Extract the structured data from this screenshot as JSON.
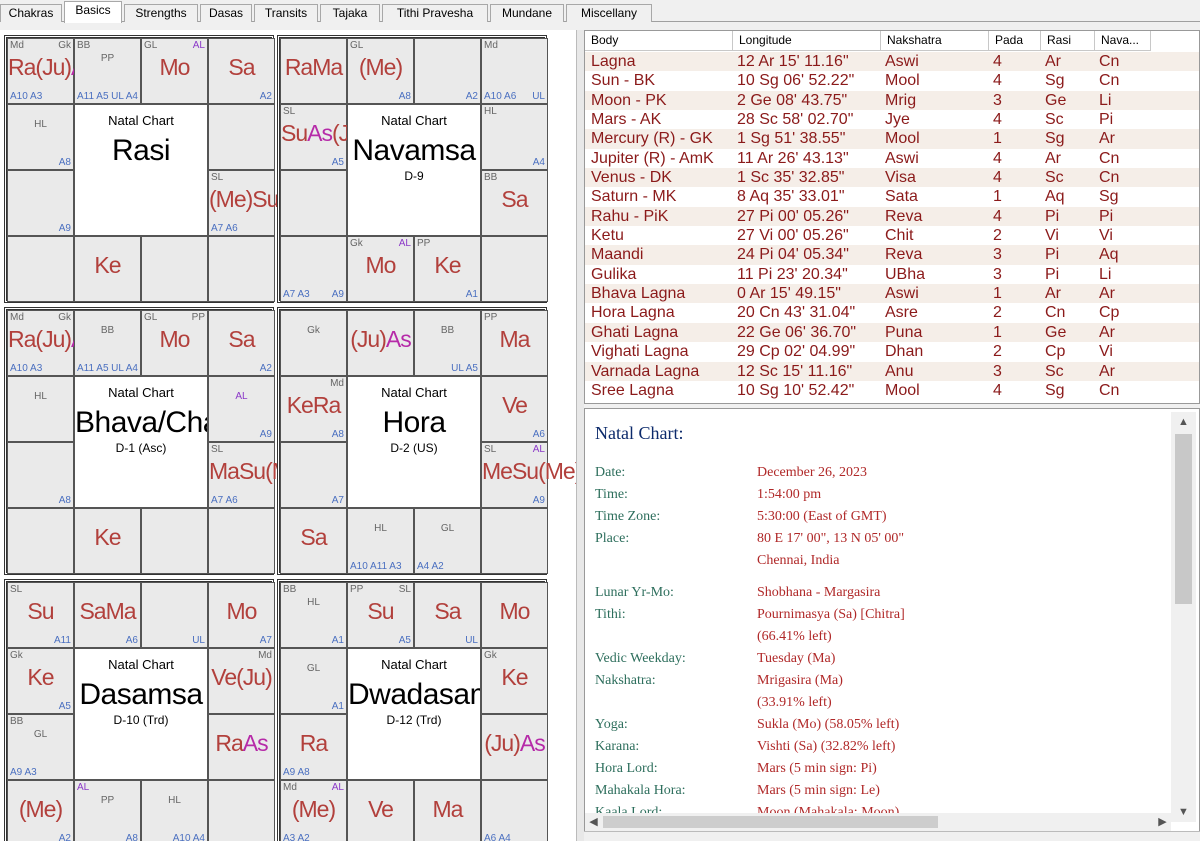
{
  "tabs": [
    "Chakras",
    "Basics",
    "Strengths",
    "Dasas",
    "Transits",
    "Tajaka",
    "Tithi Pravesha",
    "Mundane",
    "Miscellany"
  ],
  "active_tab": "Basics",
  "charts": [
    {
      "title": "Natal Chart",
      "name": "Rasi",
      "sub": "",
      "cells": [
        {
          "p": [
            "Ra",
            "(Ju)",
            "As"
          ],
          "tl": "Md",
          "tr": "Gk",
          "bl": "A10  A3",
          "br": ""
        },
        {
          "p": [],
          "tl": "BB",
          "tr": "",
          "tm": "PP",
          "bl": "A11  A5",
          "br": "UL   A4"
        },
        {
          "p": [
            "Mo"
          ],
          "tl": "GL",
          "tr": "AL",
          "bl": "",
          "br": ""
        },
        {
          "p": [
            "Sa"
          ],
          "tl": "",
          "tr": "",
          "bl": "",
          "br": "A2"
        },
        {
          "p": [],
          "tl": "",
          "tr": "",
          "tm": "HL",
          "bl": "",
          "br": "A8"
        },
        {
          "p": [],
          "tl": "",
          "tr": "",
          "bl": "",
          "br": ""
        },
        {
          "p": [],
          "tl": "",
          "tr": "",
          "bl": "",
          "br": "A9"
        },
        {
          "p": [
            "(Me)",
            "Su",
            "Ve",
            "Ma"
          ],
          "tl": "SL",
          "tr": "",
          "bl": "A7  A6",
          "br": ""
        },
        {
          "p": [],
          "tl": "",
          "tr": "",
          "bl": "",
          "br": ""
        },
        {
          "p": [
            "Ke"
          ],
          "tl": "",
          "tr": "",
          "bl": "",
          "br": ""
        },
        {
          "p": [],
          "tl": "",
          "tr": "",
          "bl": "",
          "br": ""
        },
        {
          "p": [],
          "tl": "",
          "tr": "",
          "bl": "",
          "br": ""
        }
      ]
    },
    {
      "title": "Natal Chart",
      "name": "Navamsa",
      "sub": "D-9",
      "cells": [
        {
          "p": [
            "Ra",
            "Ma"
          ],
          "tl": "",
          "tr": "",
          "bl": "",
          "br": ""
        },
        {
          "p": [
            "(Me)"
          ],
          "tl": "GL",
          "tr": "",
          "bl": "",
          "br": "A8"
        },
        {
          "p": [],
          "tl": "",
          "tr": "",
          "bl": "",
          "br": "A2"
        },
        {
          "p": [],
          "tl": "Md",
          "tr": "",
          "bl": "A10  A6",
          "br": "UL"
        },
        {
          "p": [
            "Su",
            "As",
            "(Ju)",
            "Ve"
          ],
          "tl": "SL",
          "tr": "",
          "bl": "",
          "br": "A5"
        },
        {
          "p": [],
          "tl": "HL",
          "tr": "",
          "bl": "",
          "br": "A4"
        },
        {
          "p": [],
          "tl": "",
          "tr": "",
          "bl": "",
          "br": ""
        },
        {
          "p": [
            "Sa"
          ],
          "tl": "BB",
          "tr": "",
          "bl": "",
          "br": ""
        },
        {
          "p": [],
          "tl": "",
          "tr": "",
          "bl": "A7  A3",
          "br": "A9"
        },
        {
          "p": [
            "Mo"
          ],
          "tl": "Gk",
          "tr": "AL",
          "bl": "",
          "br": ""
        },
        {
          "p": [
            "Ke"
          ],
          "tl": "PP",
          "tr": "",
          "bl": "",
          "br": "A1"
        },
        {
          "p": [],
          "tl": "",
          "tr": "",
          "bl": "",
          "br": ""
        }
      ]
    },
    {
      "title": "Natal Chart",
      "name": "Bhava/Chalit",
      "sub": "D-1 (Asc)",
      "cells": [
        {
          "p": [
            "Ra",
            "(Ju)",
            "As"
          ],
          "tl": "Md",
          "tr": "Gk",
          "bl": "A10  A3",
          "br": ""
        },
        {
          "p": [],
          "tl": "",
          "tr": "",
          "tm": "BB",
          "bl": "A11  A5",
          "br": "UL   A4"
        },
        {
          "p": [
            "Mo"
          ],
          "tl": "GL",
          "tr": "PP",
          "bl": "",
          "br": ""
        },
        {
          "p": [
            "Sa"
          ],
          "tl": "",
          "tr": "",
          "bl": "",
          "br": "A2"
        },
        {
          "p": [],
          "tl": "",
          "tr": "",
          "tm": "HL",
          "bl": "",
          "br": ""
        },
        {
          "p": [],
          "tl": "",
          "tr": "",
          "tm": "AL",
          "bl": "",
          "br": "A9"
        },
        {
          "p": [],
          "tl": "",
          "tr": "",
          "bl": "",
          "br": "A8"
        },
        {
          "p": [
            "Ma",
            "Su",
            "(Me)",
            "Ve"
          ],
          "tl": "SL",
          "tr": "",
          "bl": "A7  A6",
          "br": ""
        },
        {
          "p": [],
          "tl": "",
          "tr": "",
          "bl": "",
          "br": ""
        },
        {
          "p": [
            "Ke"
          ],
          "tl": "",
          "tr": "",
          "bl": "",
          "br": ""
        },
        {
          "p": [],
          "tl": "",
          "tr": "",
          "bl": "",
          "br": ""
        },
        {
          "p": [],
          "tl": "",
          "tr": "",
          "bl": "",
          "br": ""
        }
      ]
    },
    {
      "title": "Natal Chart",
      "name": "Hora",
      "sub": "D-2 (US)",
      "cells": [
        {
          "p": [],
          "tl": "",
          "tr": "",
          "tm": "Gk",
          "bl": "",
          "br": ""
        },
        {
          "p": [
            "(Ju)",
            "As"
          ],
          "tl": "",
          "tr": "",
          "bl": "",
          "br": ""
        },
        {
          "p": [],
          "tl": "",
          "tr": "",
          "tm": "BB",
          "bl": "",
          "br": "UL  A5"
        },
        {
          "p": [
            "Ma"
          ],
          "tl": "PP",
          "tr": "",
          "bl": "",
          "br": ""
        },
        {
          "p": [
            "Ke",
            "Ra"
          ],
          "tl": "",
          "tr": "Md",
          "bl": "",
          "br": "A8"
        },
        {
          "p": [
            "Ve"
          ],
          "tl": "",
          "tr": "",
          "bl": "",
          "br": "A6"
        },
        {
          "p": [],
          "tl": "",
          "tr": "",
          "bl": "",
          "br": "A7"
        },
        {
          "p": [
            "Me",
            "Su",
            "(Me)"
          ],
          "tl": "SL",
          "tr": "AL",
          "bl": "",
          "br": "A9"
        },
        {
          "p": [
            "Sa"
          ],
          "tl": "",
          "tr": "",
          "bl": "",
          "br": ""
        },
        {
          "p": [],
          "tl": "",
          "tr": "",
          "tm": "HL",
          "bl": "A10  A11  A3",
          "br": ""
        },
        {
          "p": [],
          "tl": "",
          "tr": "",
          "tm": "GL",
          "bl": "A4  A2",
          "br": ""
        },
        {
          "p": [],
          "tl": "",
          "tr": "",
          "bl": "",
          "br": ""
        }
      ]
    },
    {
      "title": "Natal Chart",
      "name": "Dasamsa",
      "sub": "D-10 (Trd)",
      "cells": [
        {
          "p": [
            "Su"
          ],
          "tl": "SL",
          "tr": "",
          "bl": "",
          "br": "A11"
        },
        {
          "p": [
            "Sa",
            "Ma"
          ],
          "tl": "",
          "tr": "",
          "bl": "",
          "br": "A6"
        },
        {
          "p": [],
          "tl": "",
          "tr": "",
          "bl": "",
          "br": "UL"
        },
        {
          "p": [
            "Mo"
          ],
          "tl": "",
          "tr": "",
          "bl": "",
          "br": "A7"
        },
        {
          "p": [
            "Ke"
          ],
          "tl": "Gk",
          "tr": "",
          "bl": "",
          "br": "A5"
        },
        {
          "p": [
            "Ve",
            "(Ju)"
          ],
          "tl": "",
          "tr": "Md",
          "bl": "",
          "br": ""
        },
        {
          "p": [],
          "tl": "BB",
          "tr": "",
          "tm": "GL",
          "bl": "A9  A3",
          "br": ""
        },
        {
          "p": [
            "Ra",
            "As"
          ],
          "tl": "",
          "tr": "",
          "bl": "",
          "br": ""
        },
        {
          "p": [
            "(Me)"
          ],
          "tl": "",
          "tr": "",
          "bl": "",
          "br": "A2"
        },
        {
          "p": [],
          "tl": "AL",
          "tr": "",
          "tm": "PP",
          "bl": "",
          "br": "A8"
        },
        {
          "p": [],
          "tl": "",
          "tr": "",
          "tm": "HL",
          "bl": "",
          "br": "A10  A4"
        },
        {
          "p": [],
          "tl": "",
          "tr": "",
          "bl": "",
          "br": ""
        }
      ]
    },
    {
      "title": "Natal Chart",
      "name": "Dwadasamsa",
      "sub": "D-12 (Trd)",
      "cells": [
        {
          "p": [],
          "tl": "BB",
          "tr": "",
          "tm": "HL",
          "bl": "",
          "br": "A1"
        },
        {
          "p": [
            "Su"
          ],
          "tl": "PP",
          "tr": "SL",
          "bl": "",
          "br": "A5"
        },
        {
          "p": [
            "Sa"
          ],
          "tl": "",
          "tr": "",
          "bl": "",
          "br": "UL"
        },
        {
          "p": [
            "Mo"
          ],
          "tl": "",
          "tr": "",
          "bl": "",
          "br": ""
        },
        {
          "p": [],
          "tl": "",
          "tr": "",
          "tm": "GL",
          "bl": "",
          "br": "A1"
        },
        {
          "p": [
            "Ke"
          ],
          "tl": "Gk",
          "tr": "",
          "bl": "",
          "br": ""
        },
        {
          "p": [
            "Ra"
          ],
          "tl": "",
          "tr": "",
          "bl": "A9  A8",
          "br": ""
        },
        {
          "p": [
            "(Ju)",
            "As"
          ],
          "tl": "",
          "tr": "",
          "bl": "",
          "br": ""
        },
        {
          "p": [
            "(Me)"
          ],
          "tl": "Md",
          "tr": "AL",
          "bl": "A3  A2",
          "br": ""
        },
        {
          "p": [
            "Ve"
          ],
          "tl": "",
          "tr": "",
          "bl": "",
          "br": ""
        },
        {
          "p": [
            "Ma"
          ],
          "tl": "",
          "tr": "",
          "bl": "",
          "br": ""
        },
        {
          "p": [],
          "tl": "",
          "tr": "",
          "bl": "A6  A4",
          "br": ""
        }
      ]
    }
  ],
  "table": {
    "headers": [
      "Body",
      "Longitude",
      "Nakshatra",
      "Pada",
      "Rasi",
      "Nava..."
    ],
    "rows": [
      [
        "Lagna",
        "12 Ar 15' 11.16\"",
        "Aswi",
        "4",
        "Ar",
        "Cn"
      ],
      [
        "Sun - BK",
        "10 Sg 06' 52.22\"",
        "Mool",
        "4",
        "Sg",
        "Cn"
      ],
      [
        "Moon - PK",
        " 2 Ge 08' 43.75\"",
        "Mrig",
        "3",
        "Ge",
        "Li"
      ],
      [
        "Mars - AK",
        "28 Sc 58' 02.70\"",
        "Jye",
        "4",
        "Sc",
        "Pi"
      ],
      [
        "Mercury (R) - GK",
        " 1 Sg 51' 38.55\"",
        "Mool",
        "1",
        "Sg",
        "Ar"
      ],
      [
        "Jupiter (R) - AmK",
        "11 Ar 26' 43.13\"",
        "Aswi",
        "4",
        "Ar",
        "Cn"
      ],
      [
        "Venus - DK",
        " 1 Sc 35' 32.85\"",
        "Visa",
        "4",
        "Sc",
        "Cn"
      ],
      [
        "Saturn - MK",
        " 8 Aq 35' 33.01\"",
        "Sata",
        "1",
        "Aq",
        "Sg"
      ],
      [
        "Rahu - PiK",
        "27 Pi 00' 05.26\"",
        "Reva",
        "4",
        "Pi",
        "Pi"
      ],
      [
        "Ketu",
        "27 Vi 00' 05.26\"",
        "Chit",
        "2",
        "Vi",
        "Vi"
      ],
      [
        "Maandi",
        "24 Pi 04' 05.34\"",
        "Reva",
        "3",
        "Pi",
        "Aq"
      ],
      [
        "Gulika",
        "11 Pi 23' 20.34\"",
        "UBha",
        "3",
        "Pi",
        "Li"
      ],
      [
        "Bhava Lagna",
        " 0 Ar 15' 49.15\"",
        "Aswi",
        "1",
        "Ar",
        "Ar"
      ],
      [
        "Hora Lagna",
        "20 Cn 43' 31.04\"",
        "Asre",
        "2",
        "Cn",
        "Cp"
      ],
      [
        "Ghati Lagna",
        "22 Ge 06' 36.70\"",
        "Puna",
        "1",
        "Ge",
        "Ar"
      ],
      [
        "Vighati Lagna",
        "29 Cp 02' 04.99\"",
        "Dhan",
        "2",
        "Cp",
        "Vi"
      ],
      [
        "Varnada Lagna",
        "12 Sc 15' 11.16\"",
        "Anu",
        "3",
        "Sc",
        "Ar"
      ],
      [
        "Sree Lagna",
        "10 Sg 10' 52.42\"",
        "Mool",
        "4",
        "Sg",
        "Cn"
      ]
    ]
  },
  "details": {
    "title": "Natal Chart:",
    "rows": [
      {
        "k": "Date:",
        "v": "December 26, 2023"
      },
      {
        "k": "Time:",
        "v": "1:54:00 pm"
      },
      {
        "k": "Time Zone:",
        "v": "5:30:00 (East of GMT)"
      },
      {
        "k": "Place:",
        "v": "80 E 17' 00\", 13 N 05' 00\""
      },
      {
        "k": "",
        "v": "Chennai, India"
      },
      {
        "k": "Lunar Yr-Mo:",
        "v": "Shobhana - Margasira"
      },
      {
        "k": "Tithi:",
        "v": "Pournimasya (Sa) [Chitra]"
      },
      {
        "k": "",
        "v": "  (66.41% left)"
      },
      {
        "k": "Vedic Weekday:",
        "v": "Tuesday (Ma)"
      },
      {
        "k": "Nakshatra:",
        "v": "Mrigasira (Ma)"
      },
      {
        "k": "",
        "v": "  (33.91% left)"
      },
      {
        "k": "Yoga:",
        "v": "Sukla (Mo) (58.05% left)"
      },
      {
        "k": "Karana:",
        "v": "Vishti (Sa) (32.82% left)"
      },
      {
        "k": "Hora Lord:",
        "v": "Mars (5 min sign: Pi)"
      },
      {
        "k": "Mahakala Hora:",
        "v": "Mars (5 min sign: Le)"
      },
      {
        "k": "Kaala Lord:",
        "v": "Moon (Mahakala: Moon)"
      }
    ]
  },
  "colors": {
    "planet": "#b2403c",
    "ascendant": "#b62aa8",
    "detail_key": "#2d6e5c",
    "detail_value": "#b02828",
    "table_text": "#8b1a1a"
  }
}
